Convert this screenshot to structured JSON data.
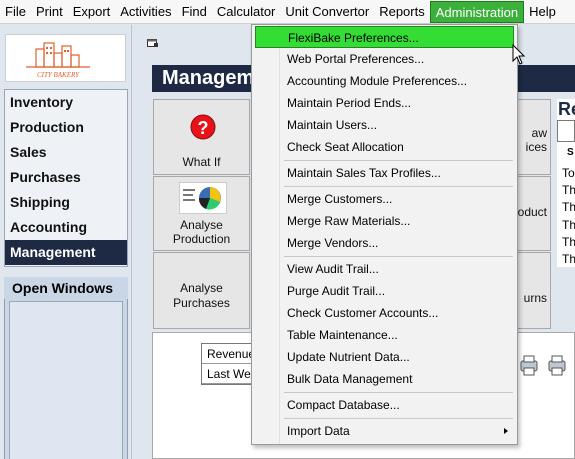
{
  "menubar": {
    "items": [
      "File",
      "Print",
      "Export",
      "Activities",
      "Find",
      "Calculator",
      "Unit Convertor",
      "Reports",
      "Administration",
      "Help"
    ],
    "active_index": 8,
    "active_color": "#3bb13b"
  },
  "sidebar": {
    "logo_icon": "city-bakery-logo",
    "logo_text": "CITY BAKERY",
    "nav": [
      "Inventory",
      "Production",
      "Sales",
      "Purchases",
      "Shipping",
      "Accounting",
      "Management"
    ],
    "selected_index": 6,
    "open_windows_label": "Open Windows"
  },
  "main": {
    "title": "Managem",
    "tiles": {
      "whatif": "What If",
      "analyse_production": "Analyse Production",
      "analyse_purchases": "Analyse Purchases",
      "right_1": "aw\nices",
      "right_2": "oduct",
      "right_3": "urns"
    },
    "report": {
      "label": "Re",
      "sub": "S",
      "lines": [
        "To",
        "Th",
        "Th",
        "Th",
        "Th",
        "Th"
      ]
    },
    "lower": {
      "rows": [
        "Revenue",
        "Last Wee"
      ]
    }
  },
  "dropdown": {
    "items": [
      "FlexiBake Preferences...",
      "Web Portal Preferences...",
      "Accounting Module Preferences...",
      "Maintain Period Ends...",
      "Maintain Users...",
      "Check Seat Allocation",
      "Maintain Sales Tax Profiles...",
      "Merge Customers...",
      "Merge Raw Materials...",
      "Merge Vendors...",
      "View Audit Trail...",
      "Purge Audit Trail...",
      "Check Customer Accounts...",
      "Table Maintenance...",
      "Update Nutrient Data...",
      "Bulk Data Management",
      "Compact Database...",
      "Import Data"
    ],
    "highlighted_index": 0,
    "highlight_color": "#33dd33"
  }
}
